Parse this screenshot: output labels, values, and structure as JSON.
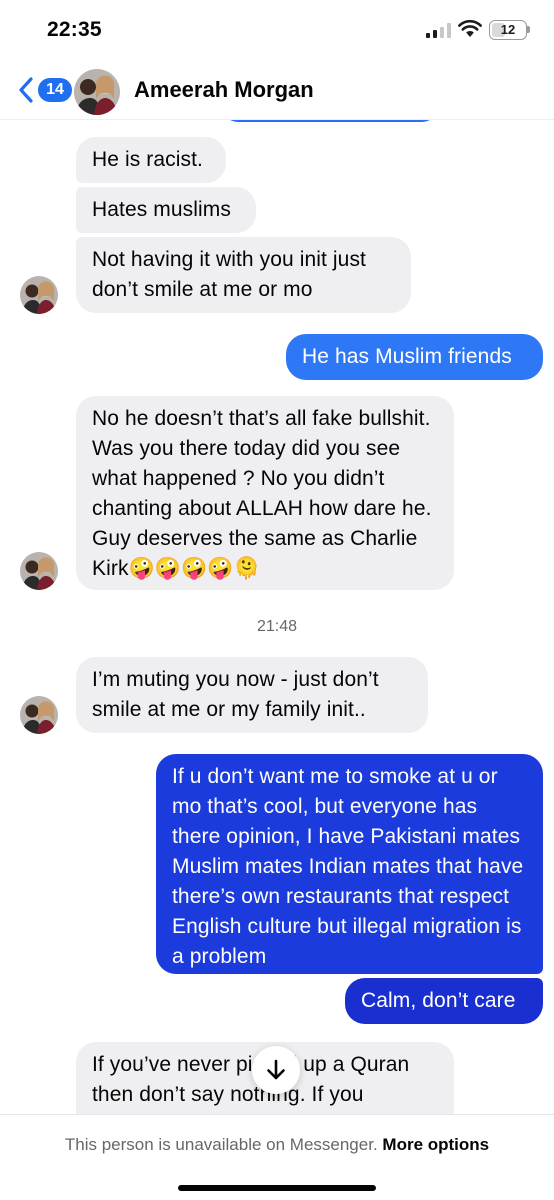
{
  "status_bar": {
    "time": "22:35",
    "battery": "12"
  },
  "header": {
    "back_count": "14",
    "contact_name": "Ameerah Morgan"
  },
  "messages": [
    {
      "text": "He is racist."
    },
    {
      "text": "Hates muslims"
    },
    {
      "text": "Not having it with you init just don’t smile at me or mo"
    },
    {
      "text": "He has Muslim friends"
    },
    {
      "text": "No he doesn’t that’s all fake bullshit. Was you there today did you see what happened ? No you didn’t chanting about ALLAH how dare he. Guy deserves the same as Charlie Kirk🤪🤪🤪🤪🫠"
    },
    {
      "text": "I’m muting you now - just don’t smile at me or my family init.."
    },
    {
      "text": "If u don’t want me to smoke at u or mo that’s cool, but everyone has there opinion, I have Pakistani mates Muslim mates Indian mates that have there’s own restaurants that respect English culture but illegal migration is a problem"
    },
    {
      "text": "Calm, don’t care"
    },
    {
      "text": "If you’ve never picked up a Quran then don’t say nothing. If you"
    }
  ],
  "timestamp": "21:48",
  "footer": {
    "text": "This person is unavailable on Messenger.",
    "link": "More options"
  },
  "colors": {
    "accent": "#1f6ff0",
    "outgoing_light": "#2f78f5",
    "outgoing_dark": "#1c3bdc",
    "incoming": "#efeff2"
  },
  "icons": [
    "back-chevron-icon",
    "signal-icon",
    "wifi-icon",
    "battery-icon",
    "arrow-down-icon"
  ]
}
